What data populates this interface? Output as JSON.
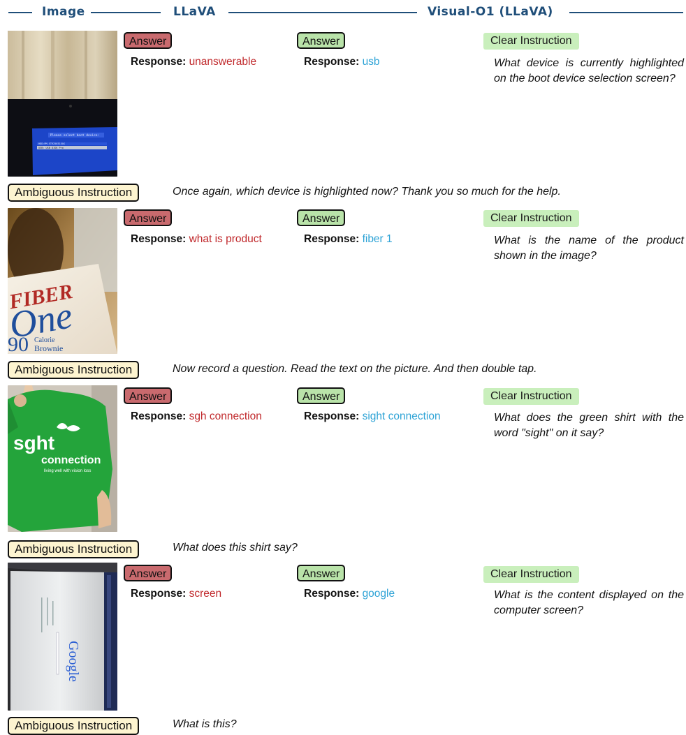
{
  "header": {
    "col_image": "Image",
    "col_llava": "LLaVA",
    "col_visual": "Visual-O1 (LLaVA)"
  },
  "labels": {
    "answer": "Answer",
    "response": "Response:",
    "clear": "Clear Instruction",
    "ambiguous": "Ambiguous Instruction"
  },
  "examples": [
    {
      "image": "boot-device-screen-photo",
      "llava_response": "unanswerable",
      "visual_response": "usb",
      "clear_instruction": "What device is currently highlighted on the boot device selection screen?",
      "ambiguous_instruction": "Once again, which device is highlighted now? Thank you so much for the help.",
      "image_text": [
        "Please select boot device:",
        "HDD:PM-ST9250315AS",
        "USB: USB DISK Pro"
      ]
    },
    {
      "image": "fiber-one-box-photo",
      "llava_response": "what is product",
      "visual_response": "fiber 1",
      "clear_instruction": "What is the name of the product shown in the image?",
      "ambiguous_instruction": "Now record a question. Read the text on the picture. And then double tap.",
      "image_text": [
        "FIBER",
        "One",
        "90",
        "Calorie",
        "Brownie"
      ]
    },
    {
      "image": "green-shirt-photo",
      "llava_response": "sgh connection",
      "visual_response": "sight connection",
      "clear_instruction": "What does the green shirt with the word \"sight\" on it say?",
      "ambiguous_instruction": "What does this shirt say?",
      "image_text": [
        "sght",
        "connection",
        "living well with vision loss"
      ]
    },
    {
      "image": "google-screen-photo",
      "llava_response": "screen",
      "visual_response": "google",
      "clear_instruction": "What is the content displayed on the computer screen?",
      "ambiguous_instruction": "What is this?",
      "image_text": [
        "Google"
      ]
    }
  ],
  "colors": {
    "header": "#1f4e79",
    "bad": "#c0282b",
    "good": "#2ea3d6",
    "answer_red": "#c96a6e",
    "answer_green": "#b9e3a9",
    "clear_bg": "#c9efbc",
    "ambiguous_bg": "#fdf4d0"
  }
}
